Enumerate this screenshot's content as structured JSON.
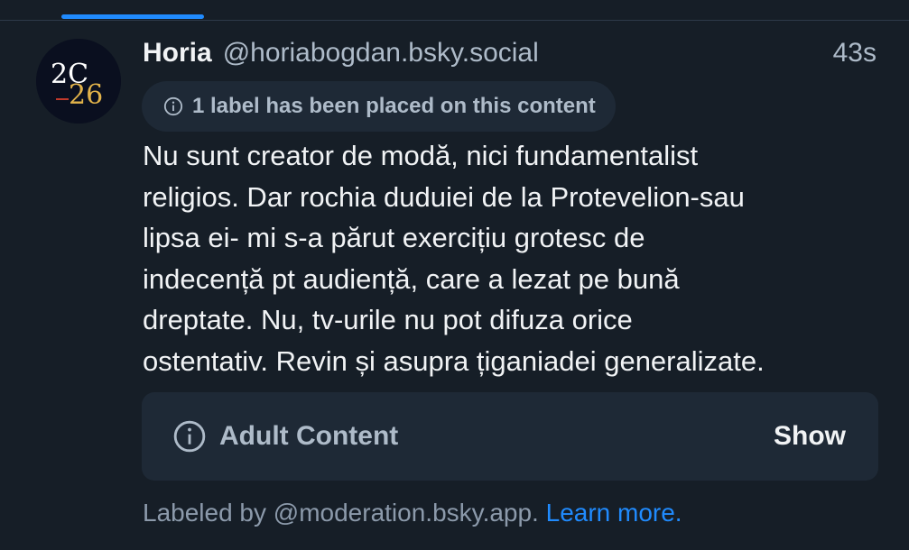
{
  "colors": {
    "background": "#161e27",
    "surface": "#1e2936",
    "accent": "#208bfe",
    "text_primary": "#f1f3f5",
    "text_secondary": "#aebbc9"
  },
  "avatar": {
    "logo_text_top": "2C",
    "logo_text_bottom": "26",
    "logo_colors": [
      "#ffffff",
      "#e2b34a"
    ]
  },
  "post": {
    "author_name": "Horia",
    "handle": "@horiabogdan.bsky.social",
    "timestamp": "43s",
    "label_notice": "1 label has been placed on this content",
    "label_notice_icon": "info-icon",
    "text": "Nu sunt creator de modă, nici fundamentalist\nreligios. Dar rochia duduiei de la Protevelion-sau\nlipsa ei- mi s-a părut exercițiu grotesc de\nindecență pt audiență, care a lezat pe bună\ndreptate. Nu, tv-urile nu pot difuza orice\nostentativ. Revin și asupra țiganiadei generalizate."
  },
  "content_warning": {
    "icon": "info-icon",
    "title": "Adult Content",
    "action_label": "Show"
  },
  "footer": {
    "labeled_by": "Labeled by @moderation.bsky.app.",
    "learn_more": "Learn more."
  }
}
